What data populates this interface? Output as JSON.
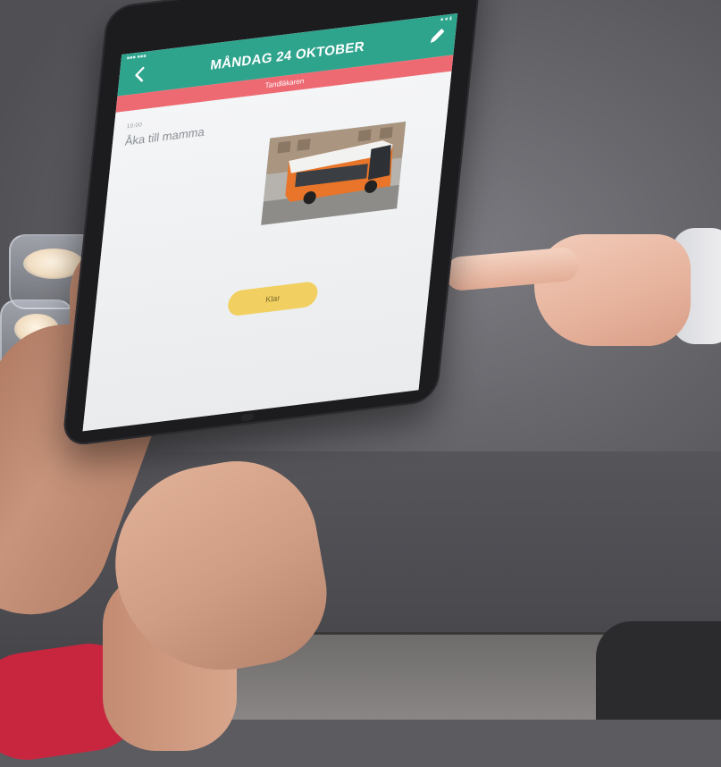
{
  "app": {
    "header": {
      "title": "MÅNDAG 24 OKTOBER",
      "back_icon": "chevron-left-icon",
      "edit_icon": "pencil-icon"
    },
    "category_label": "Tandläkaren",
    "event": {
      "time": "10:00",
      "title": "Åka till mamma",
      "photo_subject": "bus-photo"
    },
    "done_label": "Klar"
  },
  "colors": {
    "header_bg": "#2fa48d",
    "category_bg": "#ee6a73",
    "done_button_bg": "#f1d061",
    "screen_bg": "#eceef0",
    "bus_orange": "#e8752a"
  }
}
